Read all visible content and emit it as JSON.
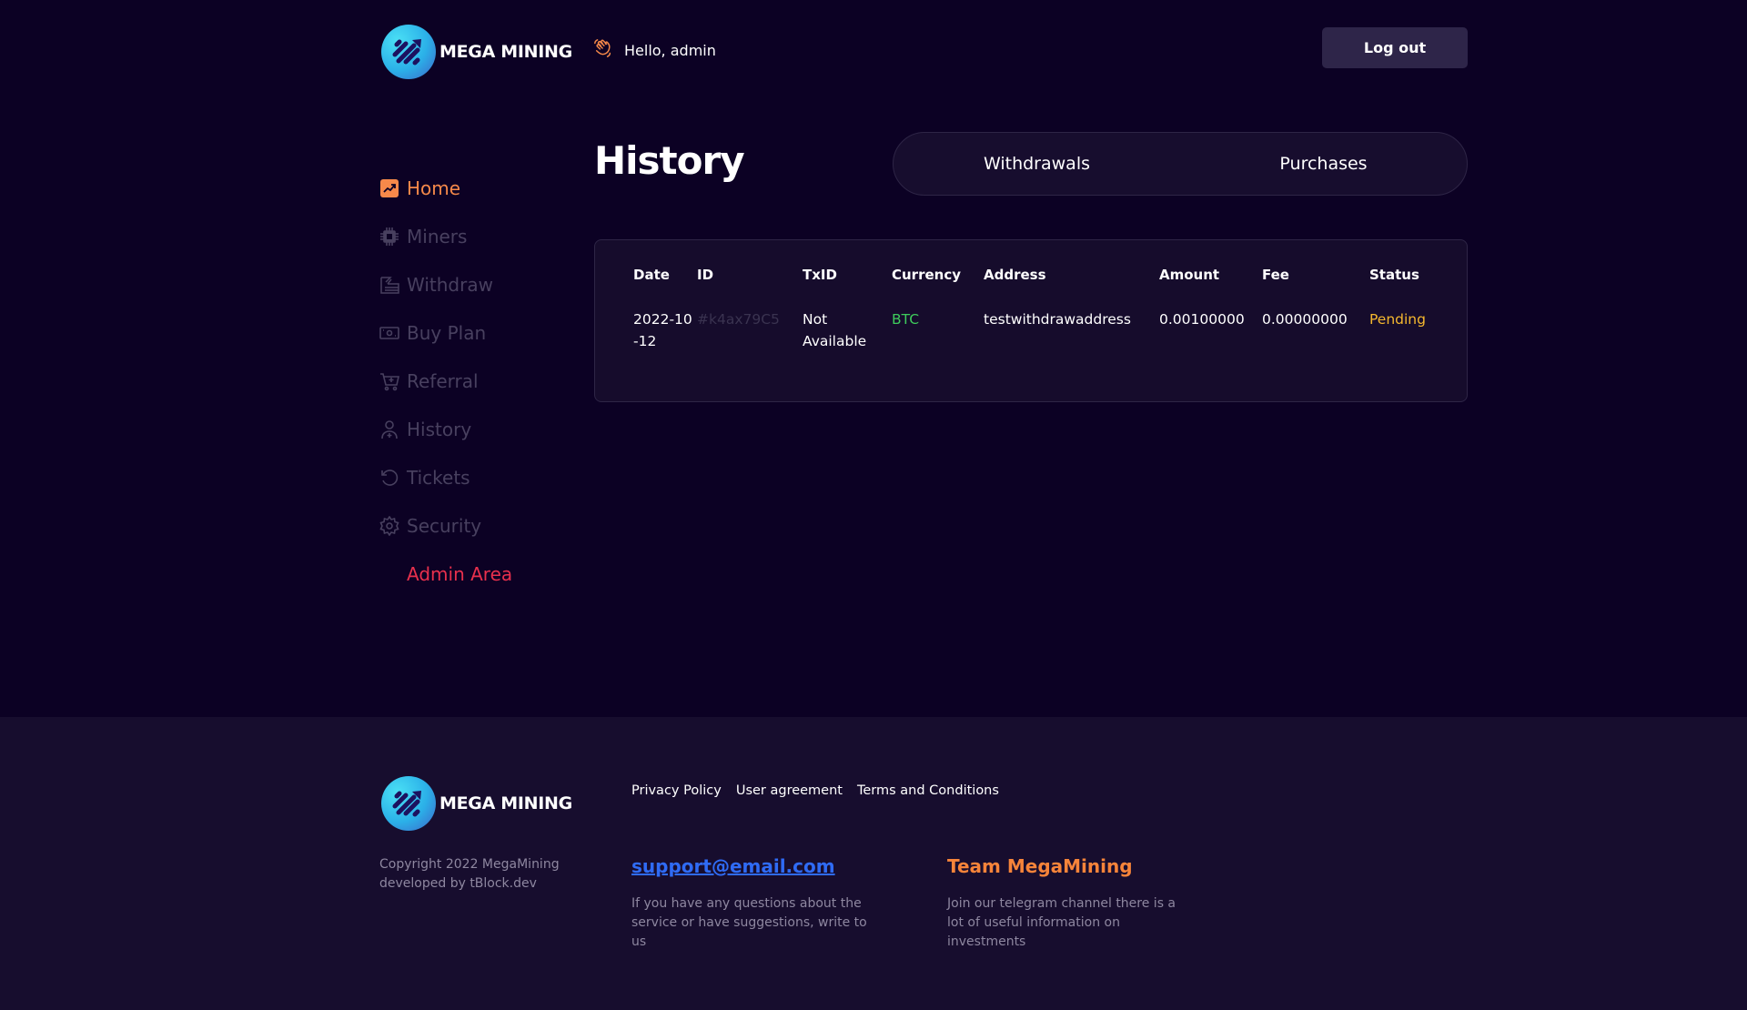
{
  "brand": {
    "name": "MEGA MINING",
    "logo_icon": "diagonal-stripes-arrow-logo"
  },
  "header": {
    "greeting_icon": "waving-hand-icon",
    "greeting": "Hello, admin",
    "logout_label": "Log out"
  },
  "sidebar": {
    "items": [
      {
        "label": "Home",
        "icon": "trend-chart-icon",
        "active": true
      },
      {
        "label": "Miners",
        "icon": "chip-icon"
      },
      {
        "label": "Withdraw",
        "icon": "withdraw-icon"
      },
      {
        "label": "Buy Plan",
        "icon": "banknote-icon"
      },
      {
        "label": "Referral",
        "icon": "cart-icon"
      },
      {
        "label": "History",
        "icon": "user-icon"
      },
      {
        "label": "Tickets",
        "icon": "refresh-icon"
      },
      {
        "label": "Security",
        "icon": "gear-icon"
      }
    ],
    "admin_label": "Admin Area"
  },
  "main": {
    "title": "History",
    "tabs": [
      {
        "label": "Withdrawals"
      },
      {
        "label": "Purchases"
      }
    ],
    "table": {
      "columns": [
        "Date",
        "ID",
        "TxID",
        "Currency",
        "Address",
        "Amount",
        "Fee",
        "Status"
      ],
      "rows": [
        {
          "date": "2022-10-12",
          "id": "#k4ax79C5",
          "txid": "Not Available",
          "currency": "BTC",
          "address": "testwithdrawaddress",
          "amount": "0.00100000",
          "fee": "0.00000000",
          "status": "Pending"
        }
      ]
    }
  },
  "colors": {
    "accent": "#f6894a",
    "admin": "#e8304d",
    "currency": "#3ecb5c",
    "pending": "#f5b82e",
    "link": "#2f6bf5"
  },
  "footer": {
    "links": [
      "Privacy Policy",
      "User agreement",
      "Terms and Conditions"
    ],
    "copyright_line1": "Copyright 2022 MegaMining",
    "copyright_line2": "developed by tBlock.dev",
    "support_email": "support@email.com",
    "support_desc": "If you have any questions about the service or have suggestions, write to us",
    "team_title": "Team MegaMining",
    "team_desc": "Join our telegram channel there is a lot of useful information on investments"
  }
}
